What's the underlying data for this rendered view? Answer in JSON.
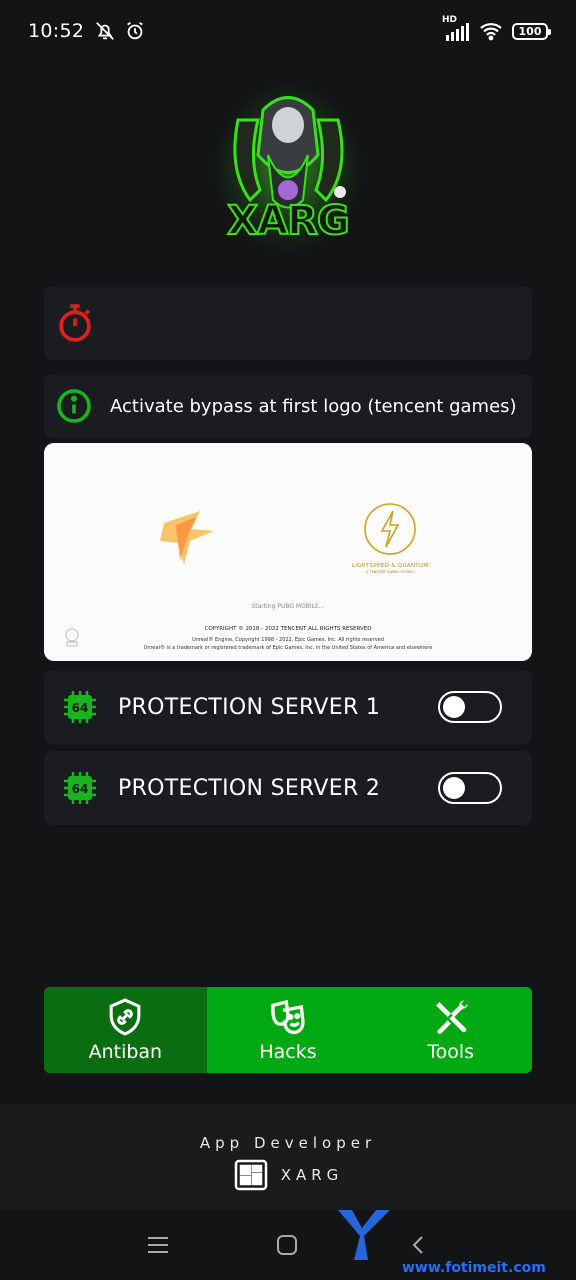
{
  "status": {
    "time": "10:52",
    "network": "HD",
    "battery": "100"
  },
  "timer_card": {
    "icon": "timer-icon",
    "text": ""
  },
  "info_card": {
    "icon": "info-icon",
    "text": "Activate bypass at first logo (tencent games)"
  },
  "preview": {
    "brand_right": "LIGHTSPEED & QUANTUM",
    "brand_right_sub": "A TENCENT GAMES STUDIO",
    "starting": "Starting PUBG MOBILE...",
    "copyright": "COPYRIGHT © 2018 - 2022 TENCENT ALL RIGHTS RESERVED",
    "legal_1": "Unreal® Engine, Copyright 1998 - 2022, Epic Games, Inc.  All rights reserved",
    "legal_2": "Unreal® is a trademark or registered trademark of Epic Games, Inc. in the United States of America and elsewhere"
  },
  "servers": [
    {
      "label": "PROTECTION SERVER 1",
      "badge": "64",
      "enabled": false
    },
    {
      "label": "PROTECTION SERVER 2",
      "badge": "64",
      "enabled": false
    }
  ],
  "bottom_nav": [
    {
      "label": "Antiban",
      "icon": "shield-link-icon",
      "active": true
    },
    {
      "label": "Hacks",
      "icon": "masks-icon",
      "active": false
    },
    {
      "label": "Tools",
      "icon": "tools-icon",
      "active": false
    }
  ],
  "footer": {
    "title": "App Developer",
    "name": "XARG"
  },
  "logo": {
    "text": "XARG"
  },
  "watermark": {
    "text": "www.fotimeit.com"
  },
  "colors": {
    "accent_green": "#00a811",
    "active_green": "#0a6d12",
    "timer_red": "#e0201f",
    "info_green": "#19b51f"
  }
}
